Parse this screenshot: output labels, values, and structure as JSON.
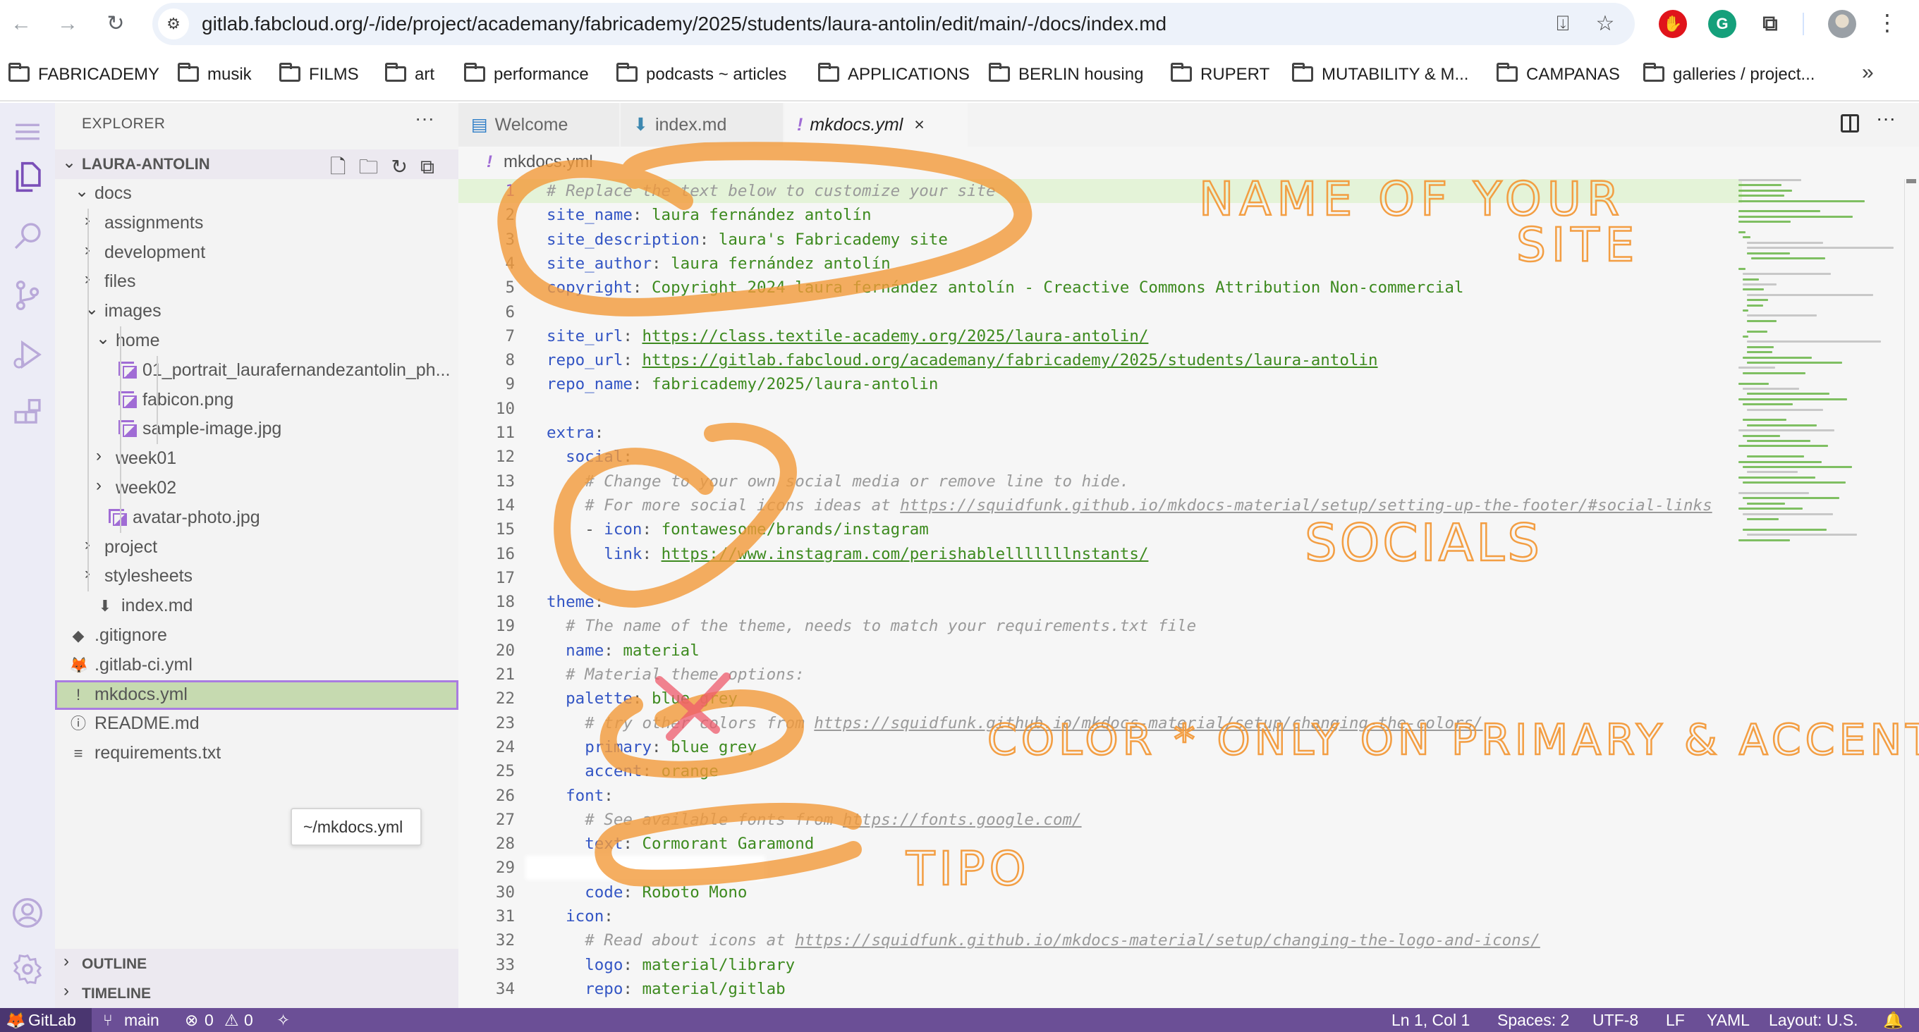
{
  "browser": {
    "url": "gitlab.fabcloud.org/-/ide/project/academany/fabricademy/2025/students/laura-antolin/edit/main/-/docs/index.md",
    "nav": {
      "back": "←",
      "forward": "→",
      "reload": "↻"
    },
    "bookmarks": [
      "FABRICADEMY",
      "musik",
      "FILMS",
      "art",
      "performance",
      "podcasts ~ articles",
      "APPLICATIONS",
      "BERLIN housing",
      "RUPERT",
      "MUTABILITY & M...",
      "CAMPANAS",
      "galleries / project..."
    ],
    "bookmarks_overflow": "»",
    "extensions": [
      {
        "name": "adblock",
        "glyph": "✋",
        "color": "#e0141b"
      },
      {
        "name": "grammarly",
        "glyph": "G",
        "color": "#15a07b"
      }
    ],
    "colors": {
      "omnibox": "#edf2fa"
    }
  },
  "explorer": {
    "title": "EXPLORER",
    "more": "···",
    "root": "LAURA-ANTOLIN",
    "tree": [
      {
        "label": "docs",
        "depth": 0,
        "kind": "folder-open"
      },
      {
        "label": "assignments",
        "depth": 1,
        "kind": "folder"
      },
      {
        "label": "development",
        "depth": 1,
        "kind": "folder"
      },
      {
        "label": "files",
        "depth": 1,
        "kind": "folder"
      },
      {
        "label": "images",
        "depth": 1,
        "kind": "folder-open"
      },
      {
        "label": "home",
        "depth": 2,
        "kind": "folder-open"
      },
      {
        "label": "01_portrait_laurafernandezantolin_ph...",
        "depth": 3,
        "kind": "image"
      },
      {
        "label": "fabicon.png",
        "depth": 3,
        "kind": "image"
      },
      {
        "label": "sample-image.jpg",
        "depth": 3,
        "kind": "image"
      },
      {
        "label": "week01",
        "depth": 2,
        "kind": "folder"
      },
      {
        "label": "week02",
        "depth": 2,
        "kind": "folder"
      },
      {
        "label": "avatar-photo.jpg",
        "depth": 2,
        "kind": "image"
      },
      {
        "label": "project",
        "depth": 1,
        "kind": "folder"
      },
      {
        "label": "stylesheets",
        "depth": 1,
        "kind": "folder"
      },
      {
        "label": "index.md",
        "depth": 1,
        "kind": "markdown"
      },
      {
        "label": ".gitignore",
        "depth": 0,
        "kind": "git"
      },
      {
        "label": ".gitlab-ci.yml",
        "depth": 0,
        "kind": "gitlab"
      },
      {
        "label": "mkdocs.yml",
        "depth": 0,
        "kind": "yaml",
        "selected": true
      },
      {
        "label": "README.md",
        "depth": 0,
        "kind": "info"
      },
      {
        "label": "requirements.txt",
        "depth": 0,
        "kind": "text"
      }
    ],
    "tooltip": "~/mkdocs.yml",
    "sections": [
      "OUTLINE",
      "TIMELINE"
    ]
  },
  "editor": {
    "tabs": [
      {
        "label": "Welcome",
        "icon": "welcome",
        "active": false
      },
      {
        "label": "index.md",
        "icon": "markdown",
        "active": false
      },
      {
        "label": "mkdocs.yml",
        "icon": "yaml",
        "active": true,
        "close": "×"
      }
    ],
    "breadcrumb": "mkdocs.yml",
    "lines": [
      {
        "n": 1,
        "indent": 0,
        "comment": "# Replace the text below to customize your site"
      },
      {
        "n": 2,
        "indent": 0,
        "key": "site_name",
        "value": "laura fernández antolín"
      },
      {
        "n": 3,
        "indent": 0,
        "key": "site_description",
        "value": "laura's Fabricademy site"
      },
      {
        "n": 4,
        "indent": 0,
        "key": "site_author",
        "value": "laura fernández antolín"
      },
      {
        "n": 5,
        "indent": 0,
        "key": "copyright",
        "value": "Copyright 2024 laura fernández antolín - Creactive Commons Attribution Non-commercial"
      },
      {
        "n": 6,
        "indent": 0
      },
      {
        "n": 7,
        "indent": 0,
        "key": "site_url",
        "value": "https://class.textile-academy.org/2025/laura-antolin/",
        "link": true
      },
      {
        "n": 8,
        "indent": 0,
        "key": "repo_url",
        "value": "https://gitlab.fabcloud.org/academany/fabricademy/2025/students/laura-antolin",
        "link": true
      },
      {
        "n": 9,
        "indent": 0,
        "key": "repo_name",
        "value": "fabricademy/2025/laura-antolin"
      },
      {
        "n": 10,
        "indent": 0
      },
      {
        "n": 11,
        "indent": 0,
        "key": "extra",
        "value": ""
      },
      {
        "n": 12,
        "indent": 1,
        "key": "social",
        "value": ""
      },
      {
        "n": 13,
        "indent": 2,
        "comment": "# Change to your own social media or remove line to hide."
      },
      {
        "n": 14,
        "indent": 2,
        "comment": "# For more social icons ideas at ",
        "comment_link": "https://squidfunk.github.io/mkdocs-material/setup/setting-up-the-footer/#social-links"
      },
      {
        "n": 15,
        "indent": 2,
        "dash": true,
        "key": "icon",
        "value": "fontawesome/brands/instagram"
      },
      {
        "n": 16,
        "indent": 3,
        "key": "link",
        "value": "https://www.instagram.com/perishablelllllllnstants/",
        "link": true
      },
      {
        "n": 17,
        "indent": 0
      },
      {
        "n": 18,
        "indent": 0,
        "key": "theme",
        "value": ""
      },
      {
        "n": 19,
        "indent": 1,
        "comment": "# The name of the theme, needs to match your requirements.txt file"
      },
      {
        "n": 20,
        "indent": 1,
        "key": "name",
        "value": "material"
      },
      {
        "n": 21,
        "indent": 1,
        "comment": "# Material theme options:"
      },
      {
        "n": 22,
        "indent": 1,
        "key": "palette",
        "value": "blue grey"
      },
      {
        "n": 23,
        "indent": 2,
        "comment": "# try other colors from ",
        "comment_link": "https://squidfunk.github.io/mkdocs-material/setup/changing-the-colors/"
      },
      {
        "n": 24,
        "indent": 2,
        "key": "primary",
        "value": "blue grey"
      },
      {
        "n": 25,
        "indent": 2,
        "key": "accent",
        "value": "orange"
      },
      {
        "n": 26,
        "indent": 1,
        "key": "font",
        "value": ""
      },
      {
        "n": 27,
        "indent": 2,
        "comment": "# See available fonts from ",
        "comment_link": "https://fonts.google.com/"
      },
      {
        "n": 28,
        "indent": 2,
        "key": "text",
        "value": "Cormorant Garamond"
      },
      {
        "n": 29,
        "indent": 2,
        "erased": true
      },
      {
        "n": 30,
        "indent": 2,
        "key": "code",
        "value": "Roboto Mono"
      },
      {
        "n": 31,
        "indent": 1,
        "key": "icon",
        "value": ""
      },
      {
        "n": 32,
        "indent": 2,
        "comment": "# Read about icons at ",
        "comment_link": "https://squidfunk.github.io/mkdocs-material/setup/changing-the-logo-and-icons/"
      },
      {
        "n": 33,
        "indent": 2,
        "key": "logo",
        "value": "material/library"
      },
      {
        "n": 34,
        "indent": 2,
        "key": "repo",
        "value": "material/gitlab"
      }
    ],
    "colors": {
      "key": "#3355c4",
      "value": "#3d8a1f",
      "comment": "#9a9a9a",
      "current_line": "#e4f3d8"
    }
  },
  "annotations": {
    "notes": [
      "NAME OF YOUR SITE",
      "SOCIALS",
      "COLOR * ONLY ON PRIMARY & ACCENT",
      "TIPO"
    ],
    "color": "#f39a3a",
    "cross_color": "#ee5a6c"
  },
  "statusbar": {
    "remote": "GitLab",
    "branch": "main",
    "errors": "0",
    "warnings": "0",
    "position": "Ln 1, Col 1",
    "spaces": "Spaces: 2",
    "encoding": "UTF-8",
    "eol": "LF",
    "language": "YAML",
    "layout": "Layout: U.S.",
    "colors": {
      "bg": "#6b4f96",
      "remote_bg": "#4a3670"
    }
  }
}
